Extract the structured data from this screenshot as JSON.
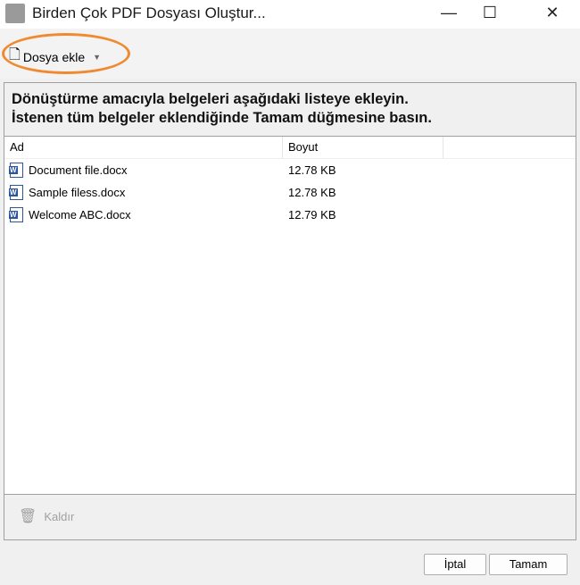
{
  "window": {
    "title": "Birden Çok PDF Dosyası Oluştur...",
    "minimize": "—",
    "maximize": "☐",
    "close": "✕"
  },
  "toolbar": {
    "add_label": "Dosya ekle"
  },
  "instructions": [
    "Dönüştürme amacıyla belgeleri aşağıdaki listeye ekleyin.",
    "İstenen tüm belgeler eklendiğinde Tamam düğmesine basın."
  ],
  "table": {
    "columns": [
      "Ad",
      "Boyut"
    ],
    "rows": [
      {
        "name": "Document file.docx",
        "size": "12.78 KB"
      },
      {
        "name": "Sample filess.docx",
        "size": "12.78 KB"
      },
      {
        "name": "Welcome ABC.docx",
        "size": "12.79 KB"
      }
    ]
  },
  "footer": {
    "remove_label": "Kaldır"
  },
  "buttons": {
    "cancel": "İptal",
    "ok": "Tamam"
  },
  "colors": {
    "highlight": "#f08a30",
    "word": "#2b579a"
  }
}
